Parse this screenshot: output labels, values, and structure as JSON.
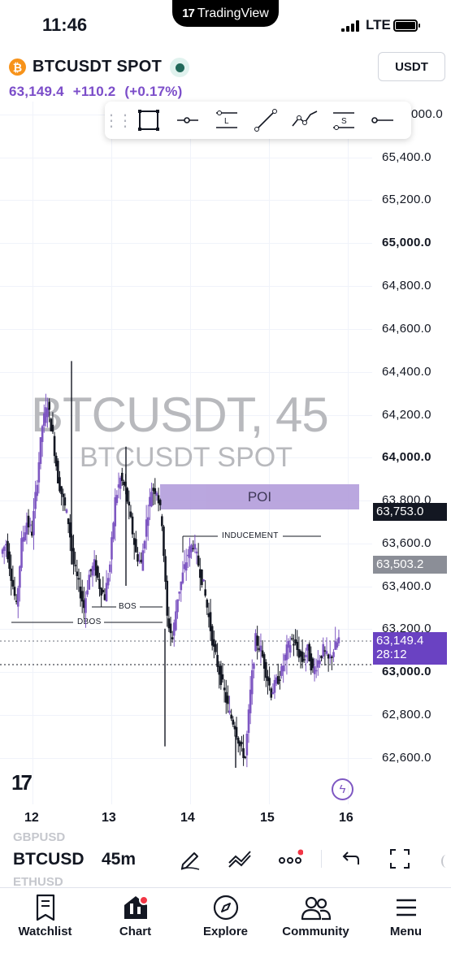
{
  "status_bar": {
    "time": "11:46",
    "app_pill": "TradingView",
    "network": "LTE"
  },
  "header": {
    "symbol": "BTCUSDT SPOT",
    "currency": "USDT",
    "price": "63,149.4",
    "change": "+110.2",
    "change_pct": "(+0.17%)"
  },
  "toolbar": {
    "tools": [
      "rectangle-icon",
      "horizontal-ray-icon",
      "long-position-icon",
      "trend-line-icon",
      "path-icon",
      "short-position-icon",
      "horizontal-line-icon"
    ],
    "long_letter": "L",
    "short_letter": "S"
  },
  "chart": {
    "watermark_title": "BTCUSDT, 45",
    "watermark_subtitle": "BTCUSDT SPOT",
    "y_ticks": [
      "65,600.0",
      "65,400.0",
      "65,200.0",
      "65,000.0",
      "64,800.0",
      "64,600.0",
      "64,400.0",
      "64,200.0",
      "64,000.0",
      "63,800.0",
      "63,600.0",
      "63,400.0",
      "63,200.0",
      "63,000.0",
      "62,800.0",
      "62,600.0"
    ],
    "y_visible_tick_text": [
      "000.0",
      "65,400.0",
      "65,200.0",
      "65,000.0",
      "64,800.0",
      "64,600.0",
      "64,400.0",
      "64,200.0",
      "64,000.0",
      "63,800.0",
      "63,600.0",
      "63,400.0",
      "63,200.0",
      "63,000.0",
      "62,800.0",
      "62,600.0"
    ],
    "x_ticks": [
      "12",
      "13",
      "14",
      "15",
      "16"
    ],
    "price_tags": {
      "poi_top": "63,753.0",
      "inducement": "63,503.2",
      "last_price": "63,149.4",
      "countdown": "28:12"
    },
    "annotations": {
      "poi": "POI",
      "inducement": "INDUCEMENT",
      "bos": "BOS",
      "dbos": "DBOS"
    },
    "colors": {
      "up_candle": "#7e57c2",
      "down_candle": "#131722",
      "poi_zone": "#b39ddb",
      "last_price_tag": "#6a42c2"
    }
  },
  "chart_data": {
    "type": "candlestick",
    "title": "BTCUSDT, 45",
    "subtitle": "BTCUSDT SPOT",
    "x_ticks": [
      "12",
      "13",
      "14",
      "15",
      "16"
    ],
    "ylim": [
      62500,
      65700
    ],
    "last_price": 63149.4,
    "levels": [
      {
        "label": "POI",
        "from": 63753,
        "to": 63870
      },
      {
        "label": "INDUCEMENT",
        "value": 63640
      },
      {
        "label": "BOS",
        "value": 63280
      },
      {
        "label": "DBOS",
        "value": 63220
      }
    ],
    "close_path": [
      63550,
      63600,
      63450,
      63300,
      63600,
      63700,
      63650,
      63900,
      64150,
      64250,
      64100,
      63900,
      63800,
      63700,
      63500,
      63400,
      63300,
      63450,
      63500,
      63400,
      63350,
      63500,
      63800,
      63900,
      63850,
      63700,
      63550,
      63500,
      63700,
      63850,
      63850,
      63700,
      63250,
      63150,
      63350,
      63450,
      63550,
      63600,
      63500,
      63400,
      63250,
      63100,
      63000,
      62900,
      62800,
      62750,
      62650,
      62600,
      62900,
      63150,
      63100,
      63000,
      62900,
      62950,
      63000,
      63100,
      63150,
      63100,
      63050,
      63100,
      63000,
      63050,
      63100,
      63050,
      63100,
      63150
    ]
  },
  "bottom_bar": {
    "symbol": "BTCUSD",
    "ghost_top": "GBPUSD",
    "ghost_bottom": "ETHUSD",
    "timeframe": "45m"
  },
  "tabs": [
    {
      "label": "Watchlist",
      "icon": "watchlist-icon"
    },
    {
      "label": "Chart",
      "icon": "chart-icon"
    },
    {
      "label": "Explore",
      "icon": "compass-icon"
    },
    {
      "label": "Community",
      "icon": "community-icon"
    },
    {
      "label": "Menu",
      "icon": "menu-icon"
    }
  ]
}
